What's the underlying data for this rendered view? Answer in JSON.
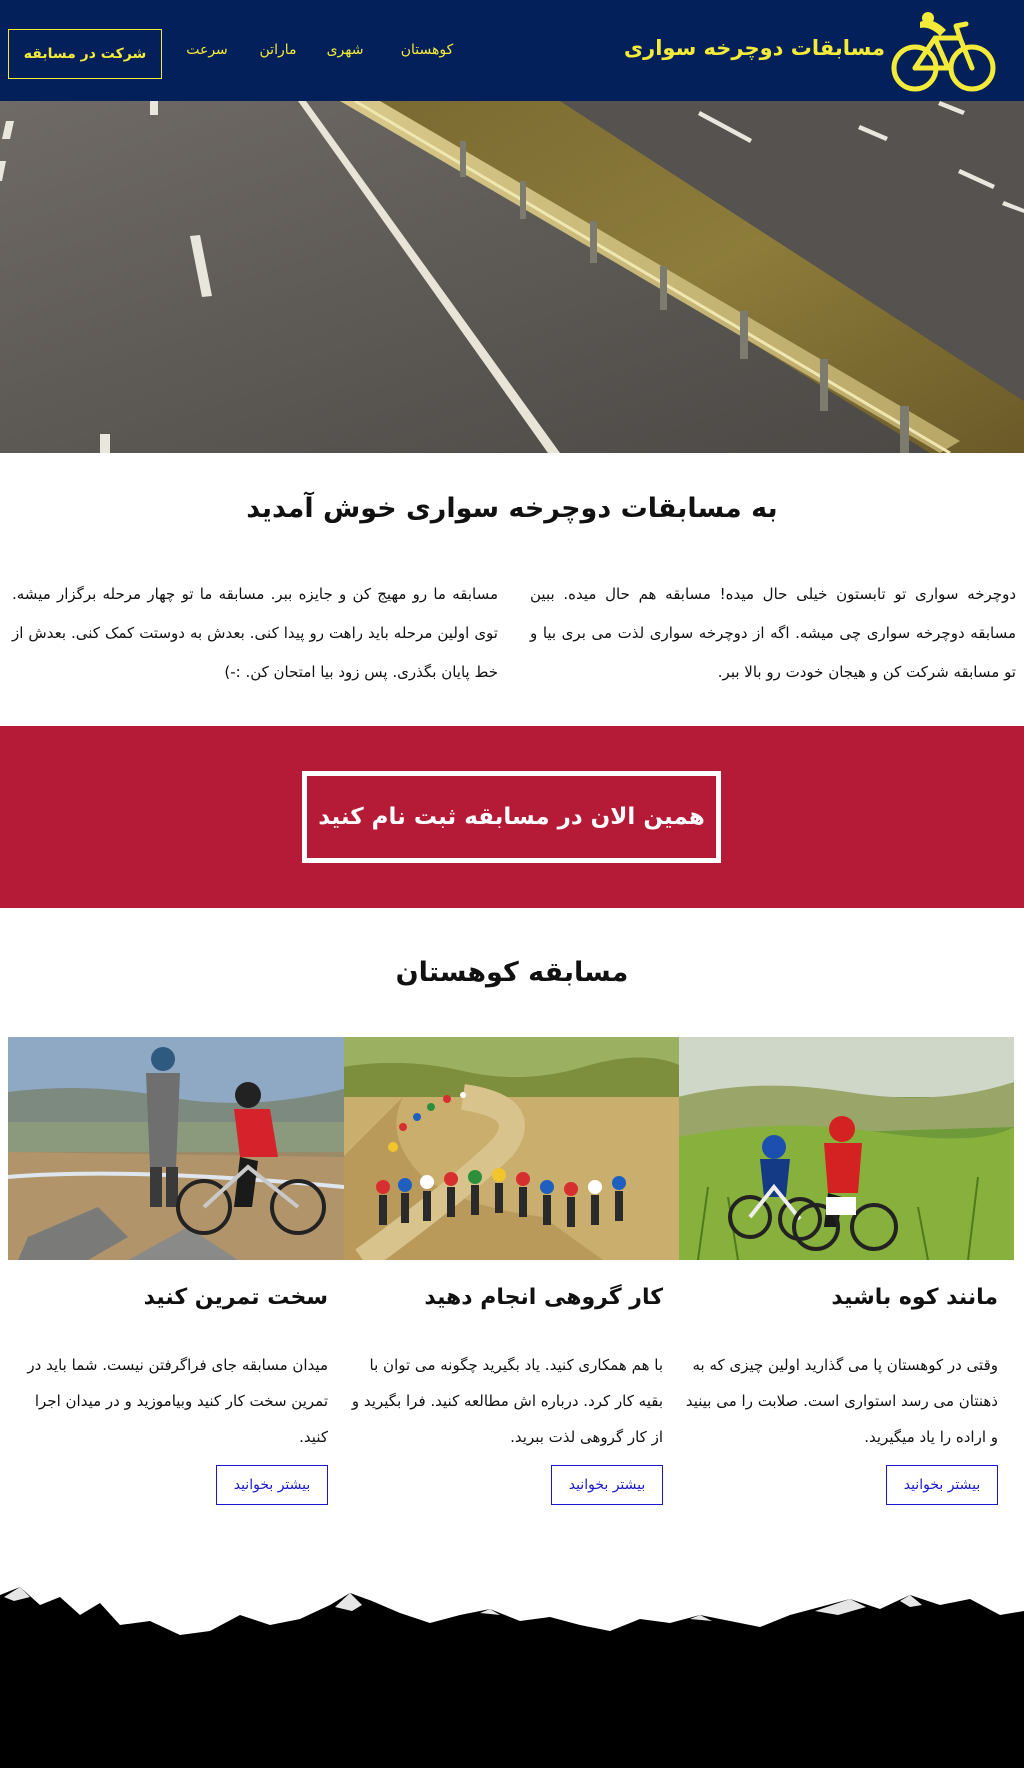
{
  "header": {
    "brand": "مسابقات دوچرخه سواری",
    "nav": [
      {
        "label": "کوهستان"
      },
      {
        "label": "شهری"
      },
      {
        "label": "ماراتن"
      },
      {
        "label": "سرعت"
      }
    ],
    "cta_label": "شرکت در مسابقه",
    "logo_icon": "bicycle-icon"
  },
  "welcome": {
    "title": "به مسابقات دوچرخه سواری خوش آمدید",
    "paragraph_right": "دوچرخه سواری تو تابستون خیلی حال میده! مسابقه هم حال میده. ببین مسابقه دوچرخه سواری چی میشه. اگه از دوچرخه سواری لذت می بری بیا و تو مسابقه شرکت کن و هیجان خودت رو بالا ببر.",
    "paragraph_left": "مسابقه ما رو مهیج کن و جایزه ببر. مسابقه ما تو چهار مرحله برگزار میشه. توی اولین مرحله باید راهت رو پیدا کنی. بعدش به دوستت کمک کنی. بعدش از خط پایان بگذری. پس زود بیا امتحان کن. :-)"
  },
  "cta": {
    "label": "همین الان در مسابقه ثبت نام کنید"
  },
  "mountain": {
    "title": "مسابقه کوهستان",
    "cards": [
      {
        "title": "مانند کوه باشید",
        "text": "وقتی در کوهستان پا می گذارید اولین چیزی که به ذهنتان می رسد استواری است. صلابت را می بینید و اراده را یاد میگیرید.",
        "button": "بیشتر بخوانید"
      },
      {
        "title": "کار گروهی انجام دهید",
        "text": "با هم همکاری کنید. یاد بگیرید چگونه می توان با بقیه کار کرد. درباره اش مطالعه کنید. فرا بگیرید و از کار گروهی لذت ببرید.",
        "button": "بیشتر بخوانید"
      },
      {
        "title": "سخت تمرین کنید",
        "text": "میدان مسابقه جای فراگرفتن نیست. شما باید در تمرین سخت کار کنید وبیاموزید و در میدان اجرا کنید.",
        "button": "بیشتر بخوانید"
      }
    ]
  },
  "colors": {
    "header_bg": "#03205a",
    "accent_yellow": "#f3ea3a",
    "cta_red": "#b51b36",
    "link_blue": "#1a1acc"
  }
}
